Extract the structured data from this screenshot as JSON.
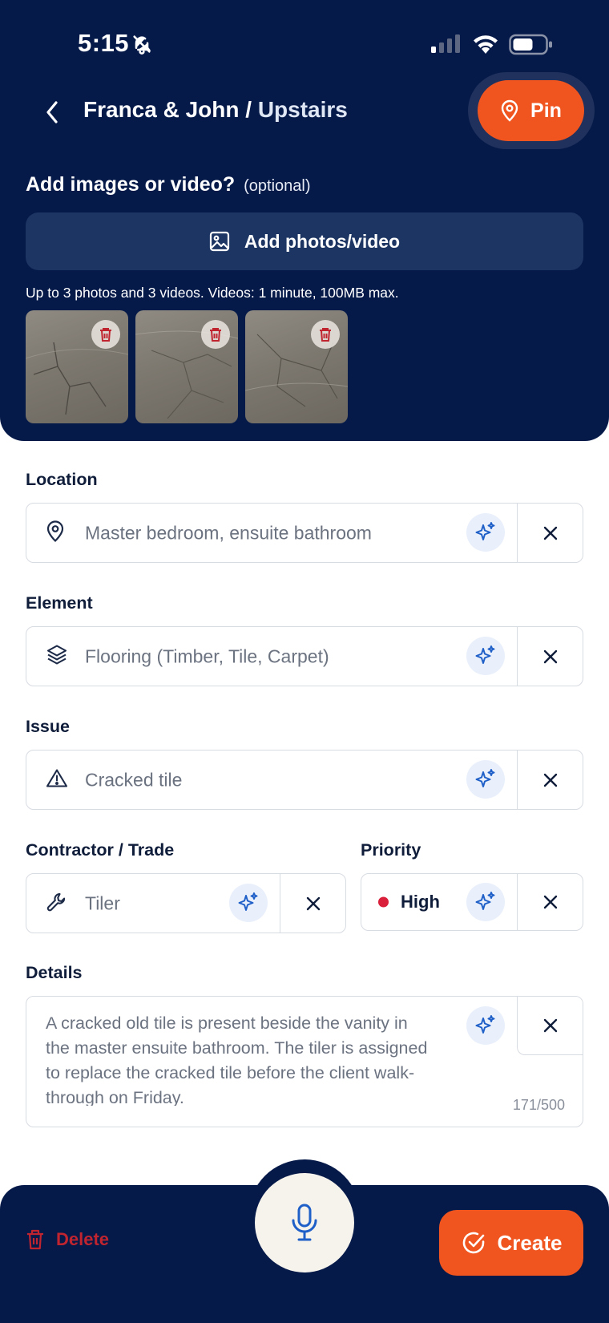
{
  "status_bar": {
    "time": "5:15",
    "icons": [
      "bell-off-icon",
      "signal-icon",
      "wifi-icon",
      "battery-icon"
    ]
  },
  "header": {
    "project": "Franca & John",
    "separator": "/",
    "area": "Upstairs",
    "pin_label": "Pin"
  },
  "media": {
    "heading": "Add images or video?",
    "optional": "(optional)",
    "add_button": "Add photos/video",
    "hint": "Up to 3 photos and 3 videos. Videos: 1 minute, 100MB max.",
    "thumbnail_count": 3
  },
  "form": {
    "location": {
      "label": "Location",
      "value": "Master bedroom, ensuite bathroom",
      "icon": "map-pin-icon"
    },
    "element": {
      "label": "Element",
      "value": "Flooring (Timber, Tile, Carpet)",
      "icon": "layers-icon"
    },
    "issue": {
      "label": "Issue",
      "value": "Cracked tile",
      "icon": "warning-icon"
    },
    "contractor": {
      "label": "Contractor / Trade",
      "value": "Tiler",
      "icon": "wrench-icon"
    },
    "priority": {
      "label": "Priority",
      "value": "High",
      "color": "#d91f3a"
    },
    "details": {
      "label": "Details",
      "value": "A cracked old tile is present beside the vanity in the master ensuite bathroom. The tiler is assigned to replace the cracked tile before the client walk-through on Friday.",
      "count": "171/500"
    }
  },
  "actions": {
    "delete_label": "Delete",
    "create_label": "Create"
  },
  "colors": {
    "navy": "#061a4a",
    "accent_orange": "#f0551f",
    "ai_blue": "#1f5fc8",
    "danger": "#c0242f"
  }
}
